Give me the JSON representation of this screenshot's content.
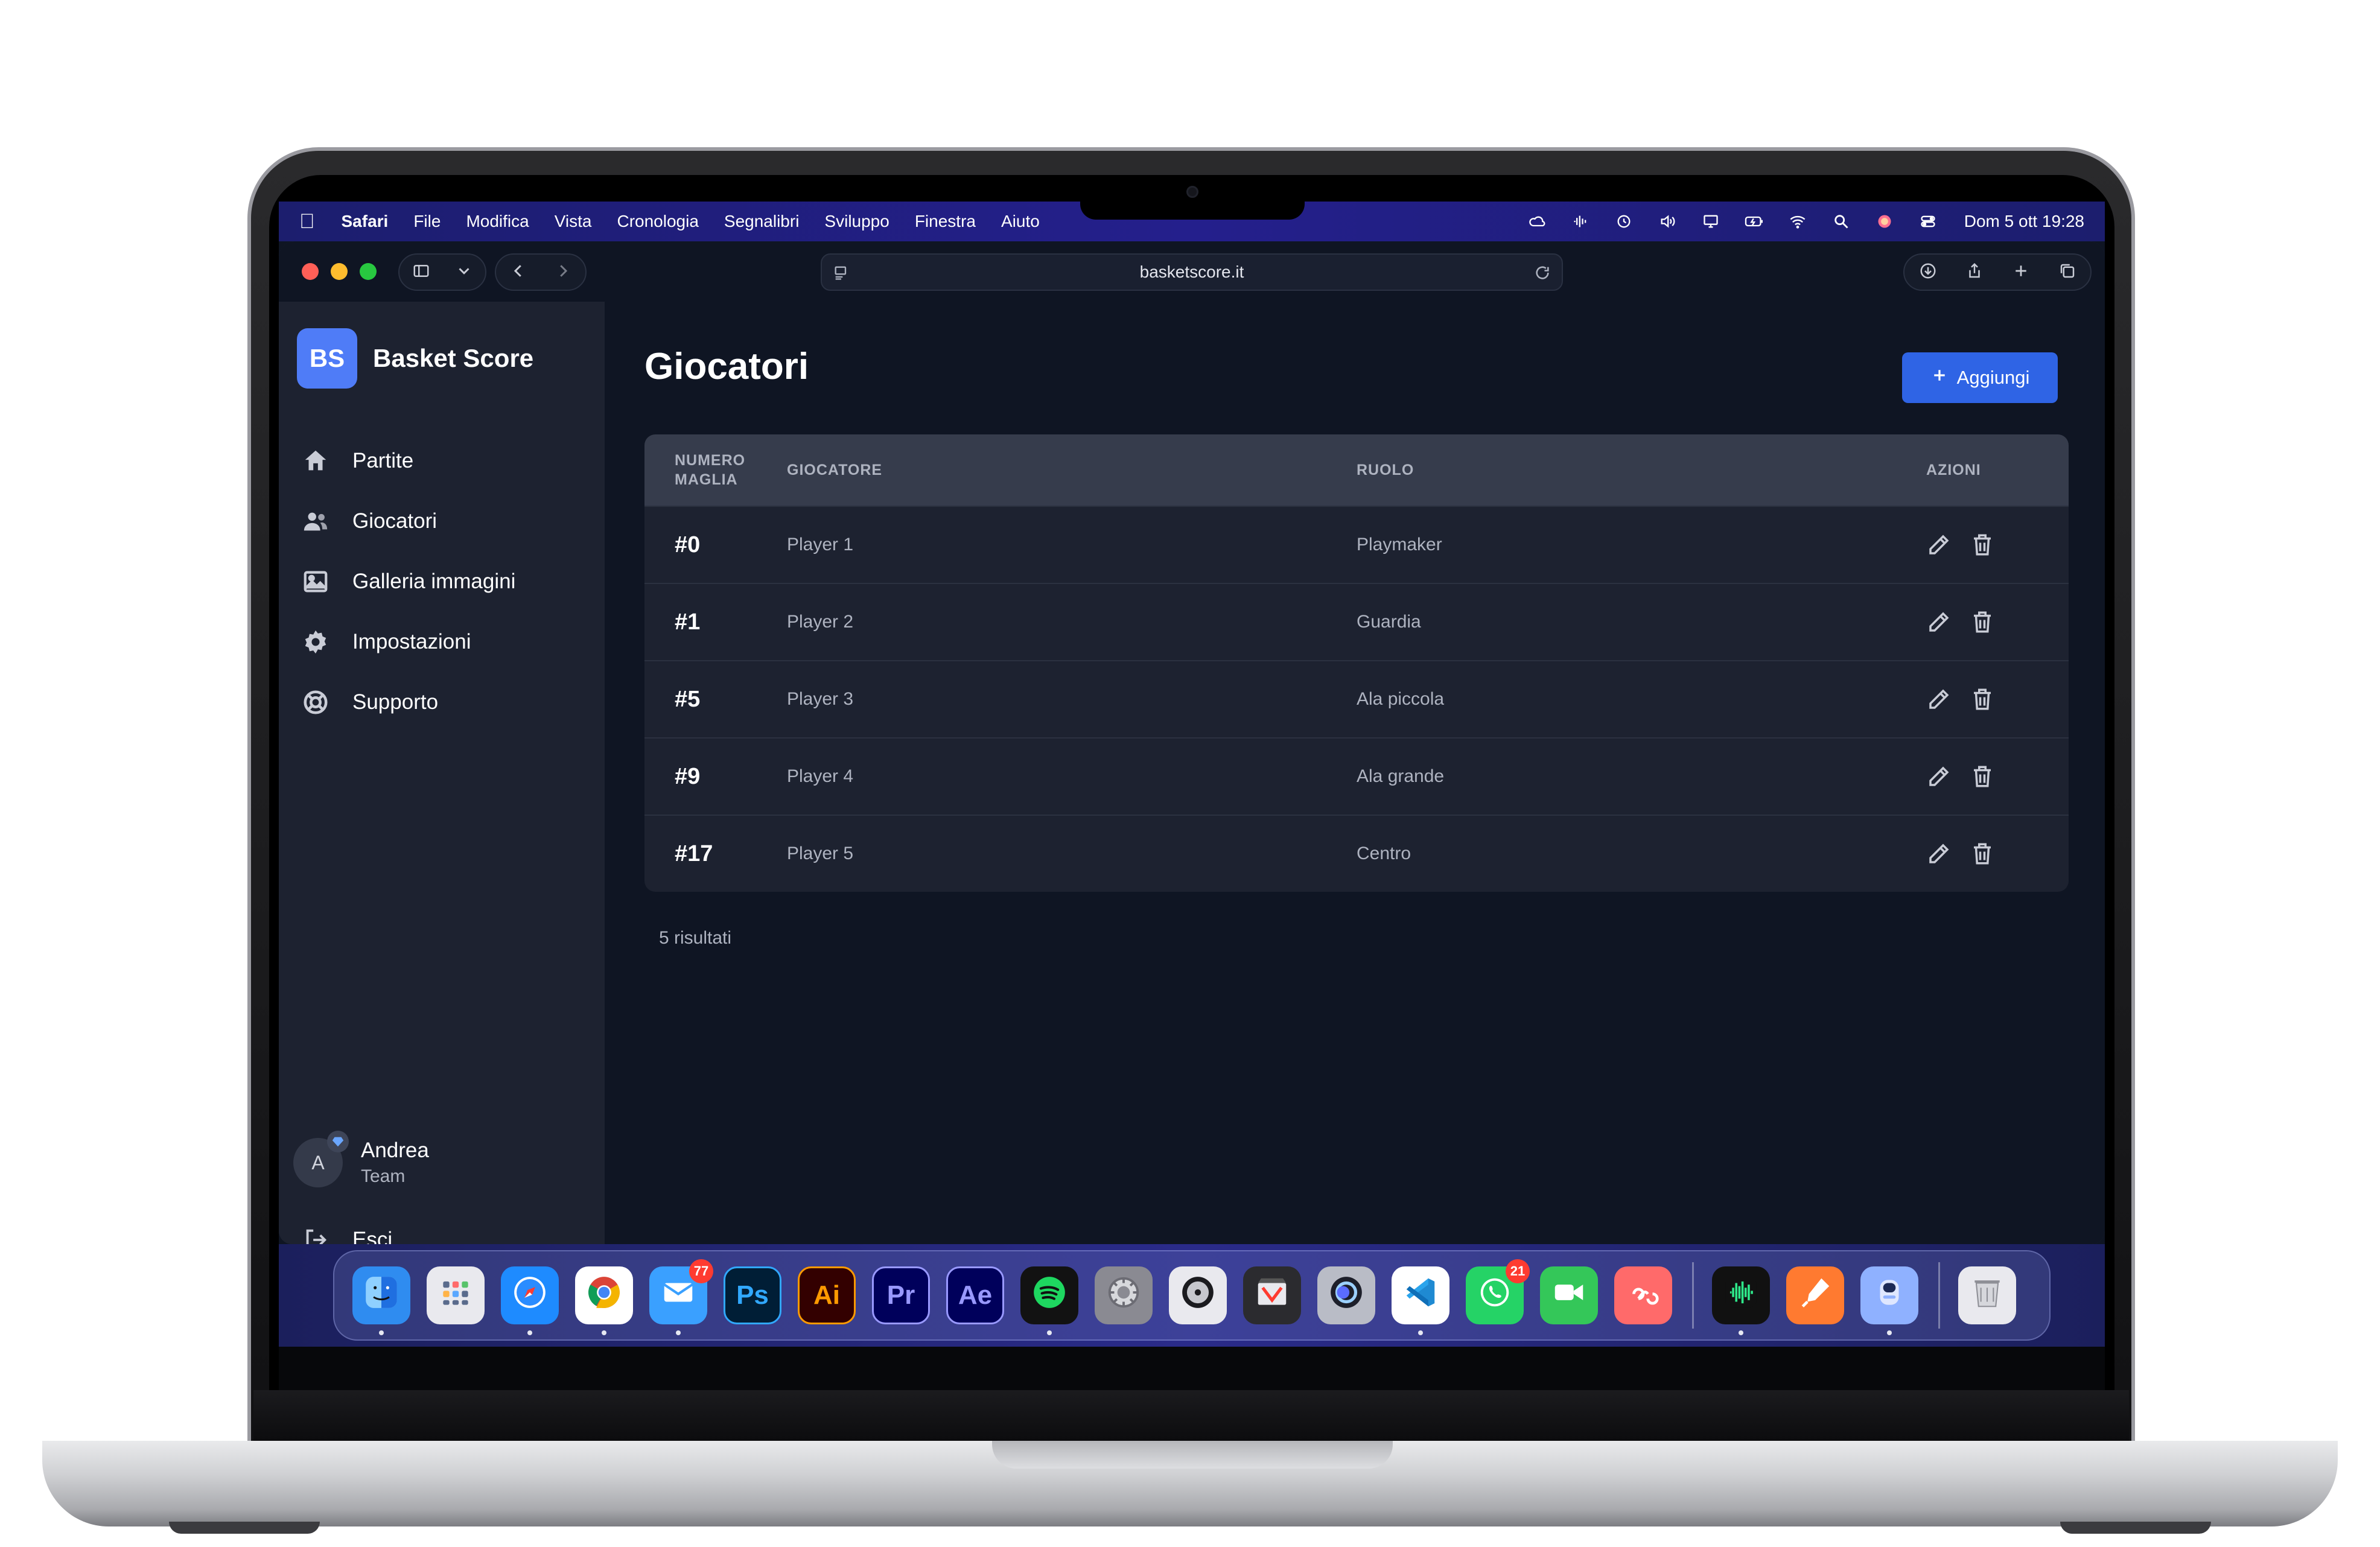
{
  "menubar": {
    "items": [
      "Safari",
      "File",
      "Modifica",
      "Vista",
      "Cronologia",
      "Segnalibri",
      "Sviluppo",
      "Finestra",
      "Aiuto"
    ],
    "status_icons": [
      "creative-cloud-icon",
      "audio-waveform-icon",
      "time-machine-icon",
      "volume-icon",
      "display-icon",
      "battery-icon",
      "wifi-icon",
      "spotlight-icon",
      "siri-icon",
      "control-center-icon"
    ],
    "clock": "Dom 5 ott  19:28"
  },
  "browser": {
    "url": "basketscore.it"
  },
  "sidebar": {
    "logo_text": "BS",
    "brand_name": "Basket Score",
    "items": [
      {
        "label": "Partite",
        "icon": "home-icon"
      },
      {
        "label": "Giocatori",
        "icon": "users-icon"
      },
      {
        "label": "Galleria immagini",
        "icon": "image-icon"
      },
      {
        "label": "Impostazioni",
        "icon": "gear-icon"
      },
      {
        "label": "Supporto",
        "icon": "lifebuoy-icon"
      }
    ],
    "user": {
      "initial": "A",
      "name": "Andrea",
      "role": "Team"
    },
    "logout_label": "Esci"
  },
  "main": {
    "title": "Giocatori",
    "add_label": "Aggiungi",
    "columns": {
      "number": "NUMERO MAGLIA",
      "player": "GIOCATORE",
      "role": "RUOLO",
      "actions": "AZIONI"
    },
    "rows": [
      {
        "number": "#0",
        "player": "Player 1",
        "role": "Playmaker"
      },
      {
        "number": "#1",
        "player": "Player 2",
        "role": "Guardia"
      },
      {
        "number": "#5",
        "player": "Player 3",
        "role": "Ala piccola"
      },
      {
        "number": "#9",
        "player": "Player 4",
        "role": "Ala grande"
      },
      {
        "number": "#17",
        "player": "Player 5",
        "role": "Centro"
      }
    ],
    "results": "5 risultati"
  },
  "dock": {
    "apps": [
      {
        "name": "finder",
        "label": "",
        "color": "#2f8cf0",
        "running": true
      },
      {
        "name": "launchpad",
        "label": "",
        "color": "#e9e9ee",
        "running": false
      },
      {
        "name": "safari",
        "label": "",
        "color": "#1e8bff",
        "running": true
      },
      {
        "name": "chrome",
        "label": "",
        "color": "#ffffff",
        "running": true
      },
      {
        "name": "mail",
        "label": "",
        "color": "#3aa0ff",
        "running": true,
        "badge": "77"
      },
      {
        "name": "photoshop",
        "label": "Ps",
        "color": "#001e36",
        "text": "#31a8ff",
        "running": false
      },
      {
        "name": "illustrator",
        "label": "Ai",
        "color": "#330000",
        "text": "#ff9a00",
        "running": false
      },
      {
        "name": "premiere",
        "label": "Pr",
        "color": "#00005b",
        "text": "#9999ff",
        "running": false
      },
      {
        "name": "after-effects",
        "label": "Ae",
        "color": "#00005b",
        "text": "#9999ff",
        "running": false
      },
      {
        "name": "spotify",
        "label": "",
        "color": "#121212",
        "running": true
      },
      {
        "name": "system-settings",
        "label": "",
        "color": "#8a8a92",
        "running": false
      },
      {
        "name": "logic",
        "label": "",
        "color": "#e9e9ee",
        "running": false
      },
      {
        "name": "final-cut",
        "label": "",
        "color": "#2b2b2f",
        "running": false
      },
      {
        "name": "motion",
        "label": "",
        "color": "#b9bcc6",
        "running": false
      },
      {
        "name": "vscode",
        "label": "",
        "color": "#ffffff",
        "running": true
      },
      {
        "name": "whatsapp",
        "label": "",
        "color": "#25d366",
        "running": false,
        "badge": "21"
      },
      {
        "name": "facetime",
        "label": "",
        "color": "#34c759",
        "running": false
      },
      {
        "name": "creative-cloud",
        "label": "",
        "color": "#ff6a6a",
        "running": false
      },
      {
        "name": "voice-memos",
        "label": "",
        "color": "#111",
        "running": true
      },
      {
        "name": "pages",
        "label": "",
        "color": "#ff7a30",
        "running": false
      },
      {
        "name": "time-machine",
        "label": "",
        "color": "#8fb1ff",
        "running": true
      },
      {
        "name": "trash",
        "label": "",
        "color": "#e9e9ee",
        "running": false
      }
    ]
  }
}
